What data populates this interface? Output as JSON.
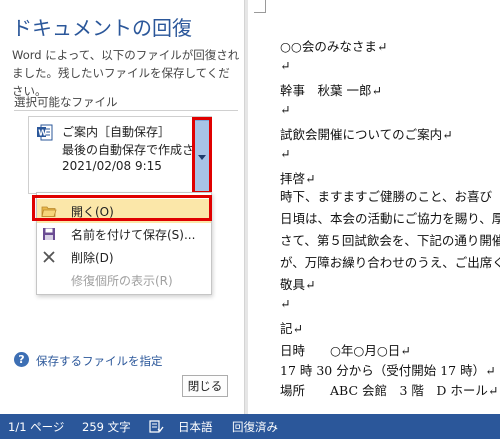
{
  "pane": {
    "title": "ドキュメントの回復",
    "description": "Word によって、以下のファイルが回復されました。残したいファイルを保存してください。",
    "section_label": "選択可能なファイル",
    "file": {
      "name": "ご案内［自動保存］",
      "status": "最後の自動保存で作成され",
      "datetime": "2021/02/08 9:15",
      "icon": "word-doc-icon"
    },
    "menu": [
      {
        "label": "開く(O)",
        "icon": "folder-open-icon"
      },
      {
        "label": "名前を付けて保存(S)...",
        "icon": "save-icon"
      },
      {
        "label": "削除(D)",
        "icon": "delete-x-icon"
      },
      {
        "label": "修復個所の表示(R)",
        "icon": ""
      }
    ],
    "help_link": "保存するファイルを指定",
    "close_label": "閉じる"
  },
  "document": {
    "lines": [
      "○○会のみなさま↵",
      "↵",
      "幹事　秋葉 一郎↵",
      "↵",
      "試飲会開催についてのご案内↵",
      "↵",
      "拝啓↵",
      "時下、ますますご健勝のこと、お喜び",
      "日頃は、本会の活動にご協力を賜り、厚",
      "さて、第５回試飲会を、下記の通り開催",
      "が、万障お繰り合わせのうえ、ご出席く",
      "敬具↵",
      "↵",
      "記↵",
      "日時　　○年○月○日↵",
      "17 時 30 分から（受付開始 17 時）↵",
      "場所　　ABC 会館　3 階　D ホール↵"
    ]
  },
  "statusbar": {
    "pages": "1/1 ページ",
    "words": "259 文字",
    "language": "日本語",
    "recovered": "回復済み"
  },
  "colors": {
    "accent": "#2b579a",
    "highlight": "#e00000",
    "menu_hover": "#fbe7a9"
  }
}
